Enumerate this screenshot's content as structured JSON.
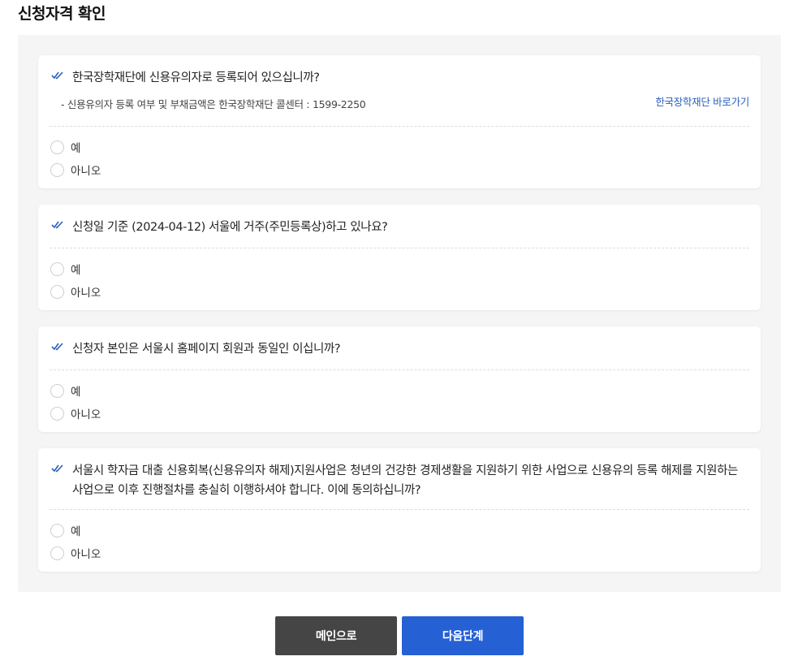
{
  "page": {
    "title": "신청자격 확인"
  },
  "questions": [
    {
      "text": "한국장학재단에 신용유의자로 등록되어 있으십니까?",
      "note": "- 신용유의자 등록 여부 및 부채금액은 한국장학재단 콜센터 : 1599-2250",
      "link": "한국장학재단 바로가기",
      "options": [
        "예",
        "아니오"
      ]
    },
    {
      "text": "신청일 기준 (2024-04-12) 서울에 거주(주민등록상)하고 있나요?",
      "options": [
        "예",
        "아니오"
      ]
    },
    {
      "text": "신청자 본인은 서울시 홈페이지 회원과 동일인 이십니까?",
      "options": [
        "예",
        "아니오"
      ]
    },
    {
      "text": "서울시 학자금 대출 신용회복(신용유의자 해제)지원사업은 청년의 건강한 경제생활을 지원하기 위한 사업으로 신용유의 등록 해제를 지원하는 사업으로 이후 진행절차를 충실히 이행하셔야 합니다. 이에 동의하십니까?",
      "options": [
        "예",
        "아니오"
      ]
    }
  ],
  "buttons": {
    "main": "메인으로",
    "next": "다음단계"
  },
  "colors": {
    "accent": "#2560d4",
    "dark_button": "#454545",
    "link": "#2a5fbf",
    "panel_bg": "#f5f5f5"
  },
  "icons": {
    "question_marker": "double-check-icon",
    "option_marker": "radio-circle"
  }
}
